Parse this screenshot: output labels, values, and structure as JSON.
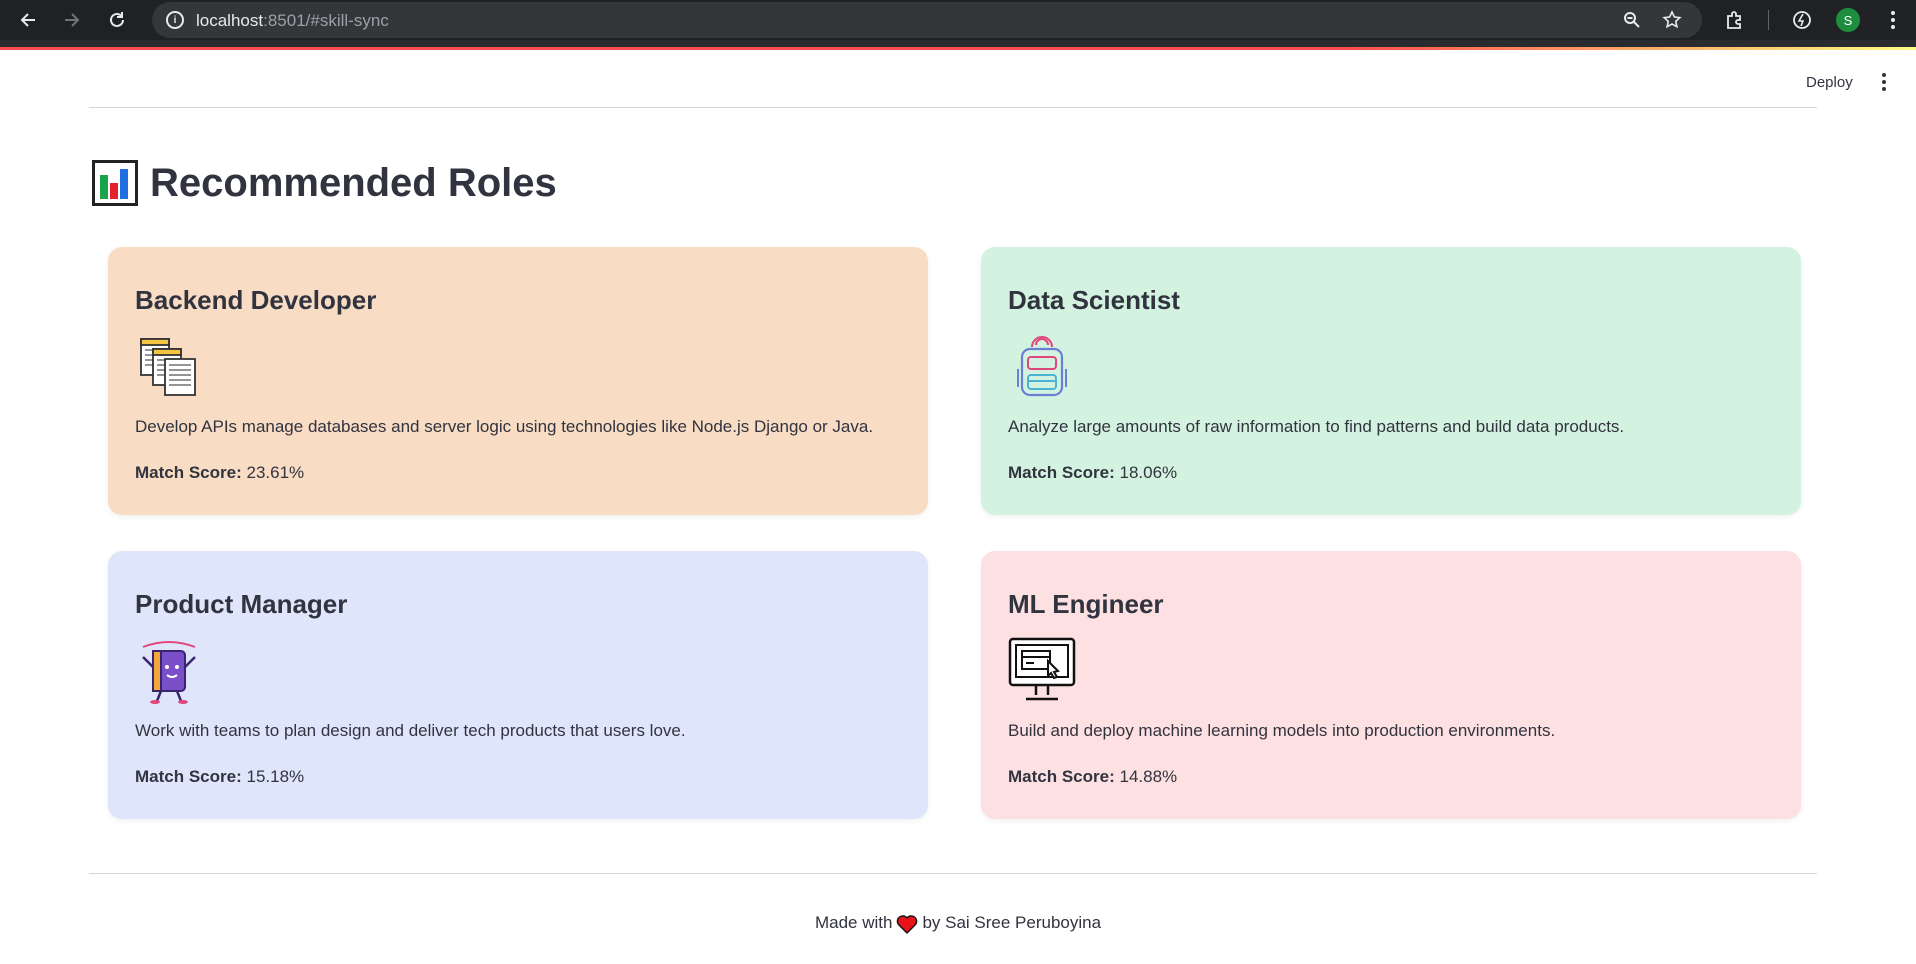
{
  "browser": {
    "url_host": "localhost",
    "url_rest": ":8501/#skill-sync",
    "profile_initial": "S"
  },
  "header": {
    "deploy_label": "Deploy"
  },
  "page": {
    "title": "Recommended Roles",
    "title_icon": "bar-chart-icon"
  },
  "cards": [
    {
      "title": "Backend Developer",
      "icon": "documents-icon",
      "description": "Develop APIs manage databases and server logic using technologies like Node.js Django or Java.",
      "score_label": "Match Score:",
      "score_value": "23.61%",
      "color": "#f8dcc4"
    },
    {
      "title": "Data Scientist",
      "icon": "backpack-icon",
      "description": "Analyze large amounts of raw information to find patterns and build data products.",
      "score_label": "Match Score:",
      "score_value": "18.06%",
      "color": "#d3f3e0"
    },
    {
      "title": "Product Manager",
      "icon": "book-character-icon",
      "description": "Work with teams to plan design and deliver tech products that users love.",
      "score_label": "Match Score:",
      "score_value": "15.18%",
      "color": "#dfe6fb"
    },
    {
      "title": "ML Engineer",
      "icon": "computer-monitor-icon",
      "description": "Build and deploy machine learning models into production environments.",
      "score_label": "Match Score:",
      "score_value": "14.88%",
      "color": "#fde0e2"
    }
  ],
  "footer": {
    "prefix": "Made with",
    "suffix": "by Sai Sree Peruboyina",
    "heart_color": "#e8121b"
  }
}
